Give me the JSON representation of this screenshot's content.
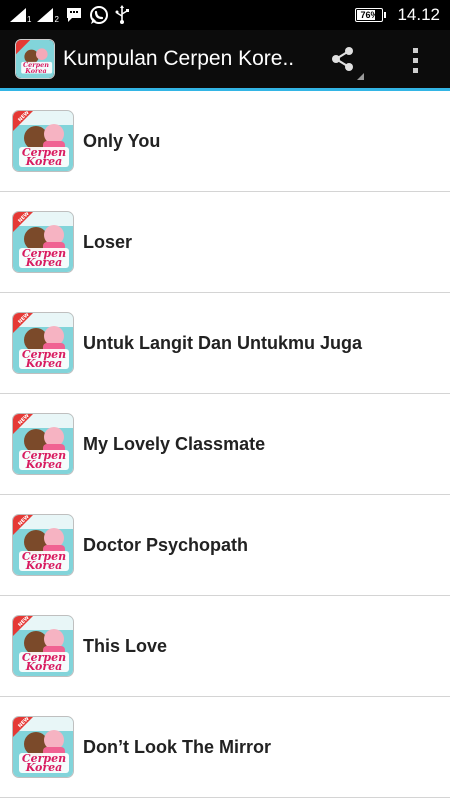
{
  "status_bar": {
    "sim1_label": "1",
    "sim2_label": "2",
    "icons": [
      "signal-icon",
      "signal-icon",
      "message-icon",
      "whatsapp-icon",
      "usb-icon"
    ],
    "battery_percent": "76%",
    "battery_level": 0.76,
    "time": "14.12"
  },
  "action_bar": {
    "title": "Kumpulan Cerpen Kore..",
    "share_icon": "share-icon",
    "overflow_icon": "more-vert-icon"
  },
  "colors": {
    "status_bar_bg": "#000000",
    "action_bar_bg": "#0c0c0c",
    "accent_line": "#33b5e5",
    "thumb_text": "#d81b60",
    "thumb_bg": "#7ed3d8"
  },
  "thumbnail": {
    "line1": "Cerpen",
    "line2": "Korea",
    "badge": "NEW"
  },
  "stories": [
    {
      "title": "Only You"
    },
    {
      "title": "Loser"
    },
    {
      "title": "Untuk Langit Dan Untukmu Juga"
    },
    {
      "title": "My Lovely Classmate"
    },
    {
      "title": "Doctor Psychopath"
    },
    {
      "title": "This Love"
    },
    {
      "title": "Don’t Look The Mirror"
    }
  ]
}
